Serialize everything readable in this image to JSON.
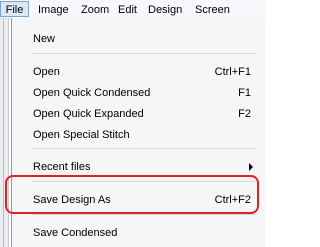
{
  "menubar": {
    "items": [
      "File",
      "Image",
      "Zoom",
      "Edit",
      "Design",
      "Screen"
    ]
  },
  "file_menu": {
    "new": "New",
    "open": {
      "label": "Open",
      "shortcut": "Ctrl+F1"
    },
    "open_quick_condensed": {
      "label": "Open Quick Condensed",
      "shortcut": "F1"
    },
    "open_quick_expanded": {
      "label": "Open Quick Expanded",
      "shortcut": "F2"
    },
    "open_special_stitch": "Open Special Stitch",
    "recent_files": "Recent files",
    "save_design_as": {
      "label": "Save Design As",
      "shortcut": "Ctrl+F2"
    },
    "save_condensed": "Save Condensed"
  },
  "colors": {
    "highlight_border": "#e52020",
    "active_menu_bg": "#dbe8f5"
  }
}
